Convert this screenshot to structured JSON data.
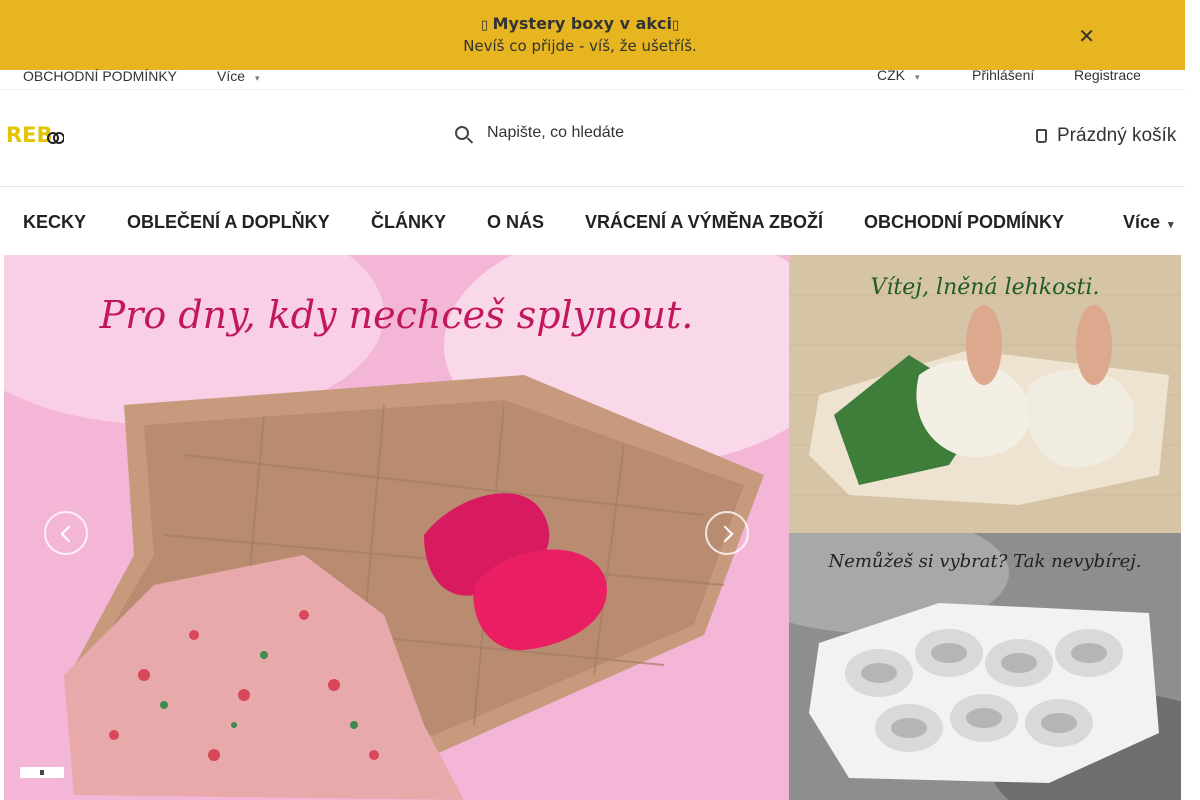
{
  "promo": {
    "title": "Mystery boxy v akci",
    "subtitle": "Nevíš co přijde - víš, že ušetříš.",
    "close_symbol": "✕",
    "icon": "package-icon"
  },
  "utility": {
    "terms": "OBCHODNÍ PODMÍNKY",
    "more": "Více",
    "currency": "CZK",
    "login": "Přihlášení",
    "register": "Registrace"
  },
  "header": {
    "search_placeholder": "Napište, co hledáte",
    "cart_label": "Prázdný košík"
  },
  "nav": {
    "items": [
      "KECKY",
      "OBLEČENÍ A DOPLŇKY",
      "ČLÁNKY",
      "O NÁS",
      "VRÁCENÍ A VÝMĚNA ZBOŽÍ",
      "OBCHODNÍ PODMÍNKY",
      "Více"
    ]
  },
  "hero": {
    "title": "Pro dny, kdy nechceš splynout."
  },
  "banners": [
    {
      "title": "Vítej, lněná lehkosti."
    },
    {
      "title": "Nemůžeš si vybrat? Tak nevybírej."
    }
  ],
  "colors": {
    "promo_bg": "#e6b51f",
    "hero_bg": "#f3b1d4",
    "hero_title": "#c2185b",
    "logo_yellow": "#e3c400"
  }
}
